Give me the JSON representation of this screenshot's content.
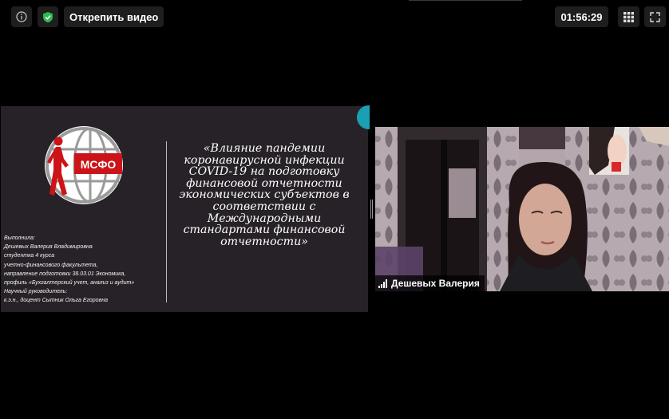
{
  "toolbar": {
    "unpin_label": "Открепить видео",
    "timer": "01:56:29",
    "info_icon": "info-icon",
    "shield_icon": "shield-check-icon",
    "grid_icon": "grid-icon",
    "fullscreen_icon": "fullscreen-icon"
  },
  "slide": {
    "logo_text": "МСФО",
    "title_lines": [
      "«Влияние пандемии",
      "коронавирусной инфекции",
      "COVID-19 на подготовку",
      "финансовой отчетности",
      "экономических субъектов в",
      "соответствии с",
      "Международными",
      "стандартами финансовой",
      "отчетности»"
    ],
    "author_lines": [
      "Выполнила:",
      "Дешевых Валерия Владимировна",
      "студентка 4 курса",
      "учетно-финансового факультета,",
      "направление подготовки 38.03.01 Экономика,",
      "профиль «Бухгалтерский учет, анализ и аудит»",
      "Научный руководитель:",
      "к.э.н., доцент Сытник Ольга Егоровна"
    ]
  },
  "participant": {
    "name": "Дешевых Валерия"
  },
  "colors": {
    "background": "#000000",
    "slide_bg": "#272227",
    "logo_red": "#cc1418",
    "accent_teal": "#1b9fb5",
    "shield_green": "#2fb84f"
  }
}
